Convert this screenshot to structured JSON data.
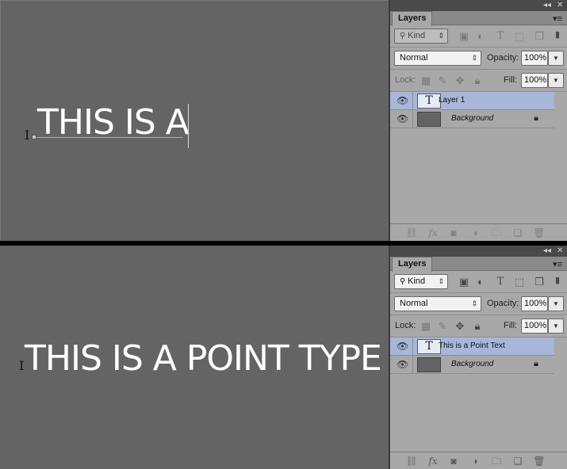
{
  "screens": [
    {
      "canvas_text": "THIS IS A",
      "panel": {
        "tab_label": "Layers",
        "collapse_glyph": "◂◂",
        "close_glyph": "✕",
        "menu_glyph": "▾≡",
        "filter": {
          "label": "Kind",
          "icon": "search-icon"
        },
        "blend_mode": "Normal",
        "opacity_label": "Opacity:",
        "opacity_value": "100%",
        "lock_label": "Lock:",
        "fill_label": "Fill:",
        "fill_value": "100%",
        "layers": [
          {
            "name": "Layer 1",
            "kind": "type",
            "thumb_glyph": "T",
            "selected": true
          },
          {
            "name": "Background",
            "kind": "background",
            "locked": true
          }
        ]
      }
    },
    {
      "canvas_text": "THIS IS A POINT TYPE",
      "panel": {
        "tab_label": "Layers",
        "collapse_glyph": "◂◂",
        "close_glyph": "✕",
        "menu_glyph": "▾≡",
        "filter": {
          "label": "Kind",
          "icon": "search-icon"
        },
        "blend_mode": "Normal",
        "opacity_label": "Opacity:",
        "opacity_value": "100%",
        "lock_label": "Lock:",
        "fill_label": "Fill:",
        "fill_value": "100%",
        "layers": [
          {
            "name": "This is a Point Text",
            "kind": "type",
            "thumb_glyph": "T",
            "selected": true
          },
          {
            "name": "Background",
            "kind": "background",
            "locked": true
          }
        ]
      }
    }
  ],
  "colors": {
    "canvas": "#646464",
    "panel": "#a8a8a8",
    "selected_layer": "#a7b6d9",
    "divider": "#000000"
  }
}
